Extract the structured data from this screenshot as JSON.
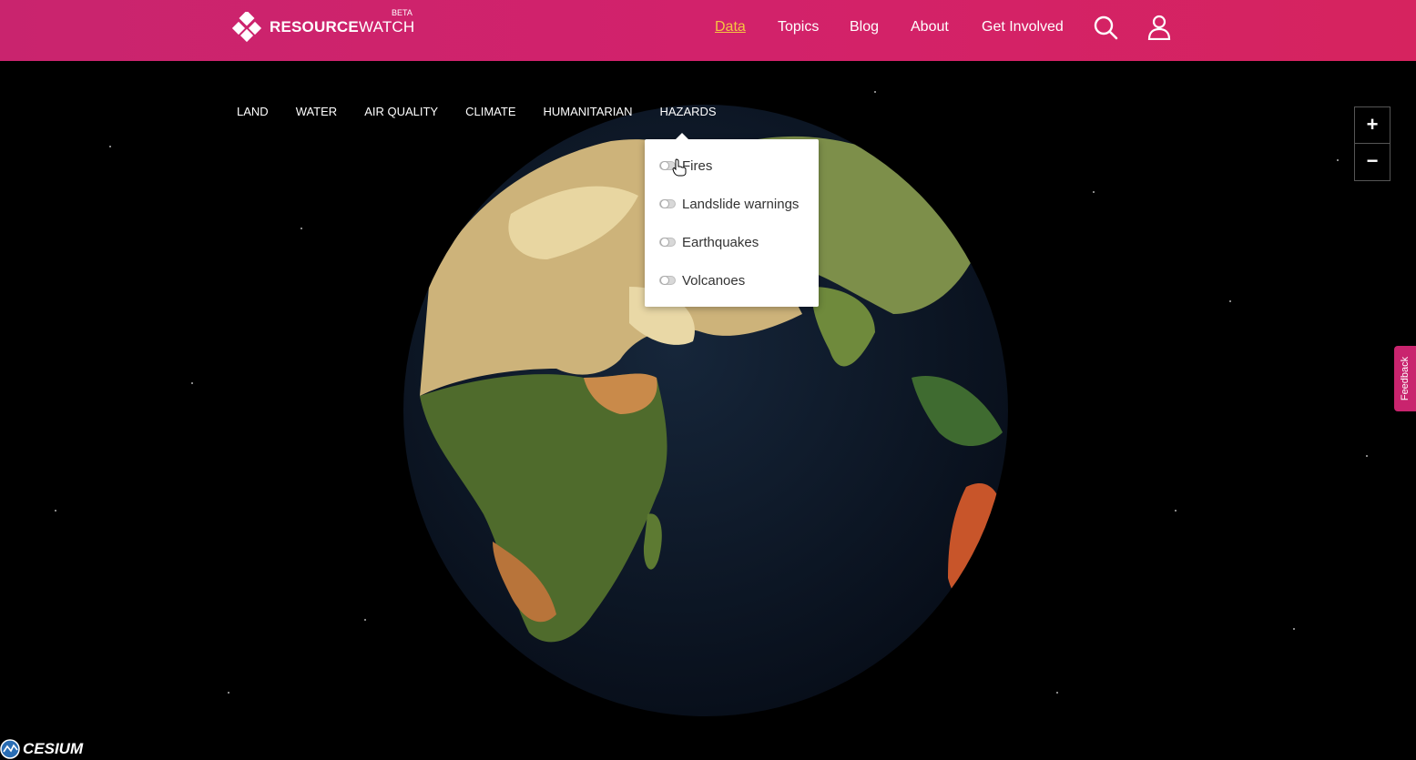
{
  "header": {
    "logo_bold": "RESOURCE",
    "logo_thin": "WATCH",
    "beta": "BETA",
    "nav": [
      {
        "label": "Data",
        "active": true
      },
      {
        "label": "Topics"
      },
      {
        "label": "Blog"
      },
      {
        "label": "About"
      },
      {
        "label": "Get Involved"
      }
    ],
    "icons": [
      "search-icon",
      "user-icon"
    ]
  },
  "categories": [
    "LAND",
    "WATER",
    "AIR QUALITY",
    "CLIMATE",
    "HUMANITARIAN",
    "HAZARDS"
  ],
  "dropdown": {
    "items": [
      {
        "label": "Fires",
        "enabled": false
      },
      {
        "label": "Landslide warnings",
        "enabled": false
      },
      {
        "label": "Earthquakes",
        "enabled": false
      },
      {
        "label": "Volcanoes",
        "enabled": false
      }
    ]
  },
  "zoom": {
    "in": "+",
    "out": "−"
  },
  "feedback": "Feedback",
  "attribution": "CESIUM",
  "colors": {
    "header": "#c9246e",
    "active_nav": "#f5c542",
    "feedback": "#c9246e"
  }
}
